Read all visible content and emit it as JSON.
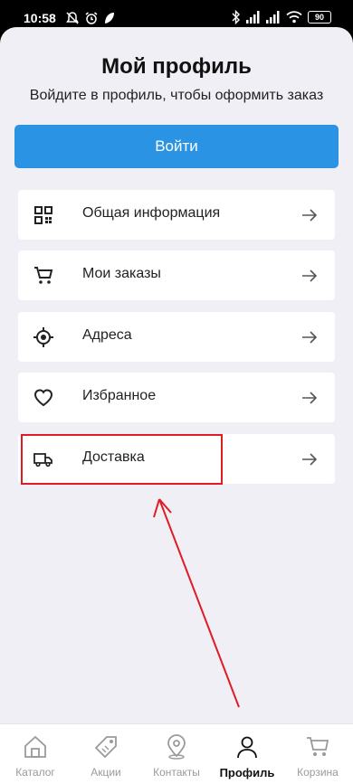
{
  "status_bar": {
    "time": "10:58",
    "battery": "90"
  },
  "header": {
    "title": "Мой профиль",
    "subtitle": "Войдите в профиль, чтобы оформить заказ"
  },
  "login_button": "Войти",
  "menu": {
    "items": [
      {
        "label": "Общая информация",
        "icon": "grid-icon"
      },
      {
        "label": "Мои заказы",
        "icon": "cart-icon"
      },
      {
        "label": "Адреса",
        "icon": "location-target-icon"
      },
      {
        "label": "Избранное",
        "icon": "heart-icon"
      },
      {
        "label": "Доставка",
        "icon": "truck-icon"
      }
    ]
  },
  "tab_bar": {
    "active": "Профиль",
    "tabs": [
      {
        "label": "Каталог",
        "icon": "home-icon"
      },
      {
        "label": "Акции",
        "icon": "tag-icon"
      },
      {
        "label": "Контакты",
        "icon": "map-pin-icon"
      },
      {
        "label": "Профиль",
        "icon": "person-icon"
      },
      {
        "label": "Корзина",
        "icon": "cart-icon"
      }
    ]
  },
  "colors": {
    "accent": "#2a93e4",
    "background": "#f0eff5",
    "annotation": "#e01b24"
  }
}
